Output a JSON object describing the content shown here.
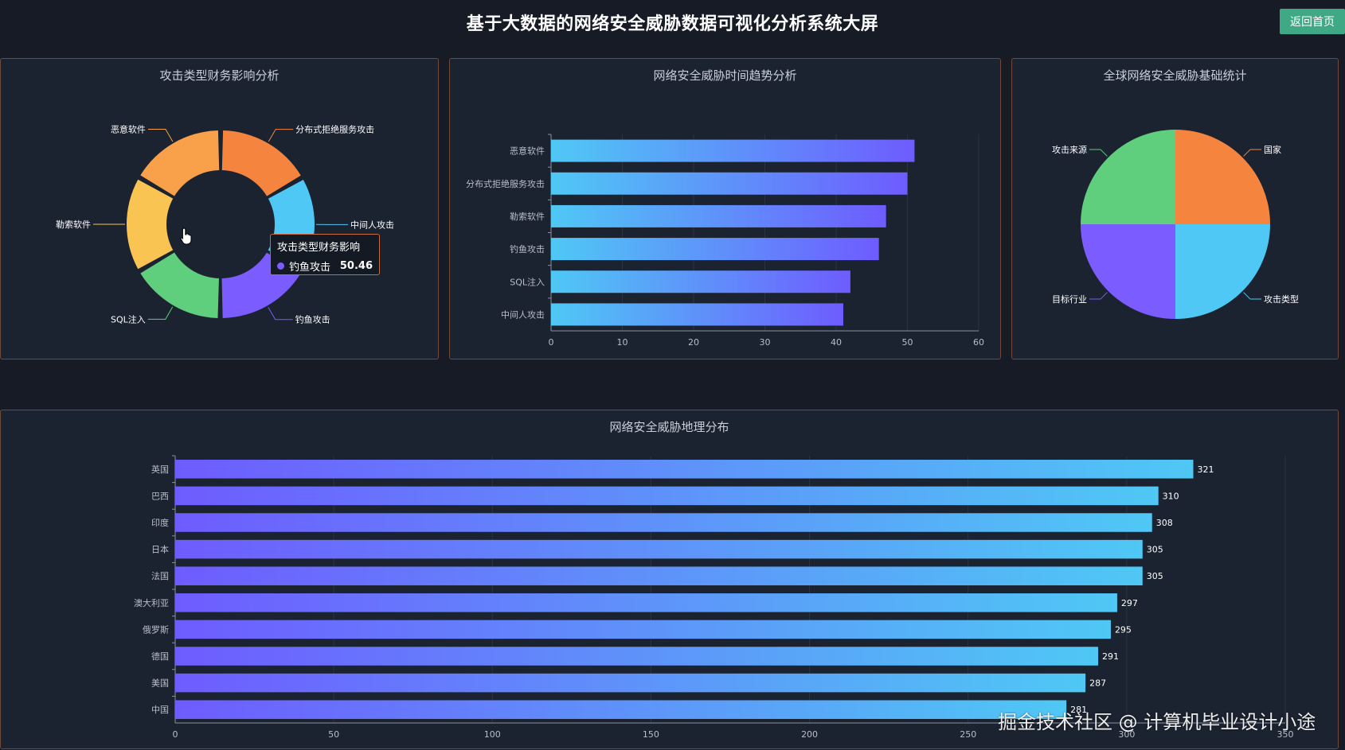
{
  "header": {
    "title": "基于大数据的网络安全威胁数据可视化分析系统大屏",
    "home_button": "返回首页"
  },
  "panels": {
    "donut": {
      "title": "攻击类型财务影响分析"
    },
    "trend": {
      "title": "网络安全威胁时间趋势分析"
    },
    "pie": {
      "title": "全球网络安全威胁基础统计"
    },
    "geo": {
      "title": "网络安全威胁地理分布"
    }
  },
  "tooltip": {
    "title": "攻击类型财务影响",
    "series_label": "钓鱼攻击",
    "value": "50.46"
  },
  "watermark": "掘金技术社区 @ 计算机毕业设计小途",
  "colors": {
    "orange": "#f5843f",
    "light_orange": "#f9a04a",
    "yellow": "#f9c452",
    "green": "#5fcf7e",
    "purple": "#7b5cff",
    "cyan": "#4fc8f5",
    "accent_button": "#3fa884"
  },
  "chart_data": [
    {
      "type": "pie",
      "subtype": "donut",
      "title": "攻击类型财务影响分析",
      "categories": [
        "分布式拒绝服务攻击",
        "中间人攻击",
        "钓鱼攻击",
        "SQL注入",
        "勒索软件",
        "恶意软件"
      ],
      "values": [
        50.5,
        50.3,
        50.46,
        50.2,
        50.3,
        50.4
      ],
      "colors": [
        "#f5843f",
        "#4fc8f5",
        "#7b5cff",
        "#5fcf7e",
        "#f9c452",
        "#f9a04a"
      ]
    },
    {
      "type": "bar",
      "orientation": "horizontal",
      "title": "网络安全威胁时间趋势分析",
      "categories": [
        "恶意软件",
        "分布式拒绝服务攻击",
        "勒索软件",
        "钓鱼攻击",
        "SQL注入",
        "中间人攻击"
      ],
      "values": [
        51,
        50,
        47,
        46,
        42,
        41
      ],
      "xlim": [
        0,
        60
      ],
      "xticks": [
        0,
        10,
        20,
        30,
        40,
        50,
        60
      ],
      "grid": true
    },
    {
      "type": "pie",
      "title": "全球网络安全威胁基础统计",
      "categories": [
        "国家",
        "攻击类型",
        "目标行业",
        "攻击来源"
      ],
      "values": [
        1,
        1,
        1,
        1
      ],
      "colors": [
        "#f5843f",
        "#4fc8f5",
        "#7b5cff",
        "#5fcf7e"
      ]
    },
    {
      "type": "bar",
      "orientation": "horizontal",
      "title": "网络安全威胁地理分布",
      "categories": [
        "英国",
        "巴西",
        "印度",
        "日本",
        "法国",
        "澳大利亚",
        "俄罗斯",
        "德国",
        "美国",
        "中国"
      ],
      "values": [
        321,
        310,
        308,
        305,
        305,
        297,
        295,
        291,
        287,
        281
      ],
      "value_labels": [
        "321",
        "310",
        "308",
        "305",
        "305",
        "297",
        "295",
        "291",
        "287",
        "281"
      ],
      "xlim": [
        0,
        350
      ],
      "xticks": [
        0,
        50,
        100,
        150,
        200,
        250,
        300,
        350
      ],
      "grid": true
    }
  ]
}
